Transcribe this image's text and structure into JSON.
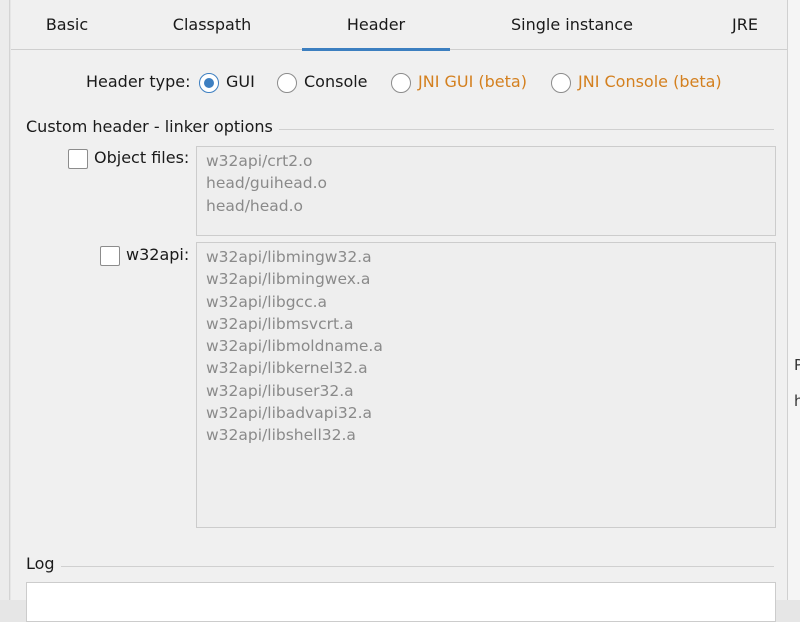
{
  "tabs": [
    {
      "label": "Basic",
      "active": false
    },
    {
      "label": "Classpath",
      "active": false
    },
    {
      "label": "Header",
      "active": true
    },
    {
      "label": "Single instance",
      "active": false
    },
    {
      "label": "JRE",
      "active": false
    }
  ],
  "header_type": {
    "label": "Header type:",
    "selected": "GUI",
    "options": [
      {
        "label": "GUI",
        "checked": true,
        "beta": false
      },
      {
        "label": "Console",
        "checked": false,
        "beta": false
      },
      {
        "label": "JNI GUI (beta)",
        "checked": false,
        "beta": true
      },
      {
        "label": "JNI Console (beta)",
        "checked": false,
        "beta": true
      }
    ]
  },
  "custom_header": {
    "title": "Custom header - linker options",
    "object_files": {
      "label": "Object files:",
      "checked": false,
      "lines": [
        "w32api/crt2.o",
        "head/guihead.o",
        "head/head.o"
      ]
    },
    "w32api": {
      "label": "w32api:",
      "checked": false,
      "lines": [
        "w32api/libmingw32.a",
        "w32api/libmingwex.a",
        "w32api/libgcc.a",
        "w32api/libmsvcrt.a",
        "w32api/libmoldname.a",
        "w32api/libkernel32.a",
        "w32api/libuser32.a",
        "w32api/libadvapi32.a",
        "w32api/libshell32.a"
      ]
    }
  },
  "log": {
    "title": "Log"
  },
  "background_fragments": [
    "P",
    "h"
  ],
  "colors": {
    "accent": "#3c7fc0",
    "beta_text": "#d4801f",
    "panel_bg": "#f0f0f0",
    "disabled_text": "#8a8a8a"
  }
}
